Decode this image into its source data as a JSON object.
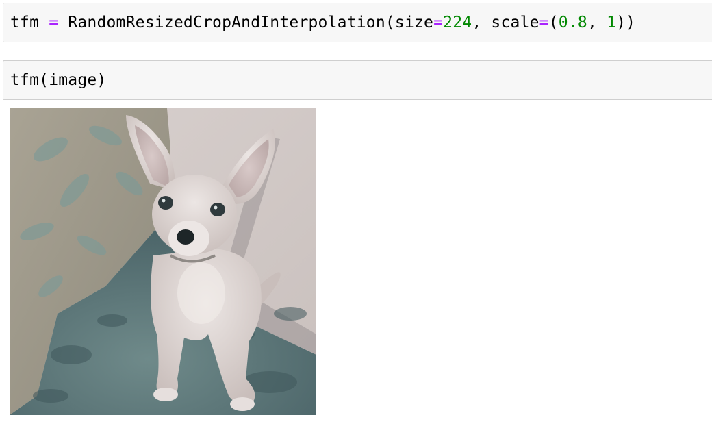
{
  "cells": [
    {
      "tokens": [
        {
          "text": "tfm ",
          "kind": "plain"
        },
        {
          "text": "=",
          "kind": "op"
        },
        {
          "text": " RandomResizedCropAndInterpolation(size",
          "kind": "plain"
        },
        {
          "text": "=",
          "kind": "op"
        },
        {
          "text": "224",
          "kind": "num"
        },
        {
          "text": ", scale",
          "kind": "plain"
        },
        {
          "text": "=",
          "kind": "op"
        },
        {
          "text": "(",
          "kind": "plain"
        },
        {
          "text": "0.8",
          "kind": "num"
        },
        {
          "text": ", ",
          "kind": "plain"
        },
        {
          "text": "1",
          "kind": "num"
        },
        {
          "text": "))",
          "kind": "plain"
        }
      ]
    },
    {
      "tokens": [
        {
          "text": "tfm(image)",
          "kind": "plain"
        }
      ]
    }
  ],
  "output": {
    "image_subject": "chihuahua-puppy"
  },
  "colors": {
    "cell_bg": "#f7f7f7",
    "cell_border": "#cfcfcf",
    "operator": "#aa22ff",
    "number": "#008800"
  }
}
